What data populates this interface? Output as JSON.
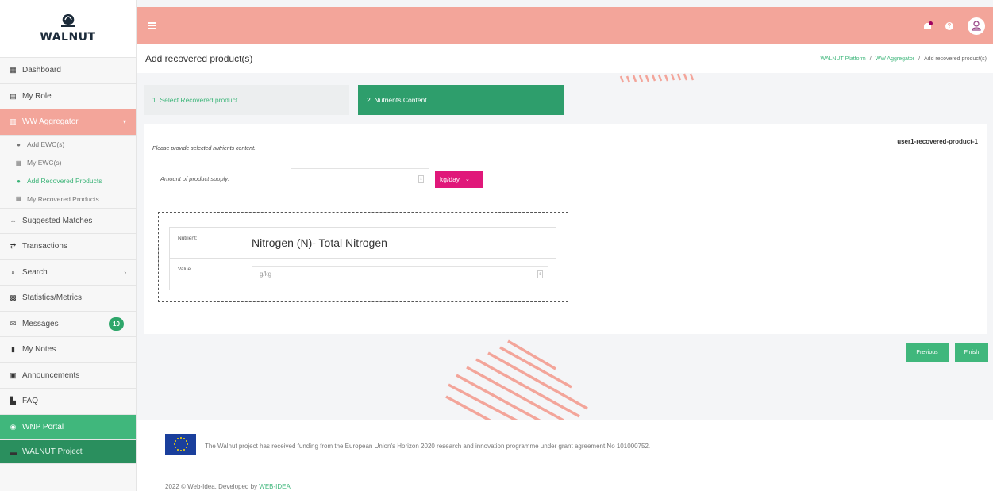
{
  "brand": {
    "name": "WALNUT"
  },
  "colors": {
    "accent": "#f3a59a",
    "green": "#40b77c",
    "magenta": "#e0187a"
  },
  "sidebar": {
    "items": [
      {
        "label": "Dashboard",
        "icon": "dashboard-icon"
      },
      {
        "label": "My Role",
        "icon": "id-card-icon"
      },
      {
        "label": "WW Aggregator",
        "icon": "grid-icon"
      },
      {
        "label": "Suggested Matches",
        "icon": "matches-icon"
      },
      {
        "label": "Transactions",
        "icon": "exchange-icon"
      },
      {
        "label": "Search",
        "icon": "search-icon"
      },
      {
        "label": "Statistics/Metrics",
        "icon": "chart-icon"
      },
      {
        "label": "Messages",
        "icon": "envelope-icon",
        "badge": "10"
      },
      {
        "label": "My Notes",
        "icon": "bookmark-icon"
      },
      {
        "label": "Announcements",
        "icon": "newspaper-icon"
      },
      {
        "label": "FAQ",
        "icon": "book-icon"
      },
      {
        "label": "WNP Portal",
        "icon": "globe-icon"
      },
      {
        "label": "WALNUT Project",
        "icon": "link-icon"
      }
    ],
    "sub_items": [
      {
        "label": "Add EWC(s)",
        "icon": "plus-circle-icon"
      },
      {
        "label": "My EWC(s)",
        "icon": "table-icon"
      },
      {
        "label": "Add Recovered Products",
        "icon": "plus-circle-icon"
      },
      {
        "label": "My Recovered Products",
        "icon": "table-icon"
      }
    ]
  },
  "header": {
    "title": "Add recovered product(s)",
    "breadcrumb": [
      "WALNUT Platform",
      "WW Aggregator",
      "Add recovered product(s)"
    ]
  },
  "steps": [
    "1. Select Recovered product",
    "2. Nutrients Content"
  ],
  "form": {
    "product_tag": "user1-recovered-product-1",
    "instruction": "Please provide selected nutrients content.",
    "supply_label": "Amount of product supply:",
    "supply_value": "",
    "unit": "kg/day",
    "nutrient_label": "Nutrient:",
    "nutrient_name": "Nitrogen (N)- Total Nitrogen",
    "value_label": "Value",
    "value_placeholder": "g/kg"
  },
  "buttons": {
    "previous": "Previous",
    "finish": "Finish"
  },
  "footer": {
    "funding": "The Walnut project has received funding from the European Union's Horizon 2020 research and innovation programme under grant agreement No 101000752.",
    "copyright": "2022 © Web-Idea. Developed by",
    "developer": "WEB-IDEA"
  }
}
